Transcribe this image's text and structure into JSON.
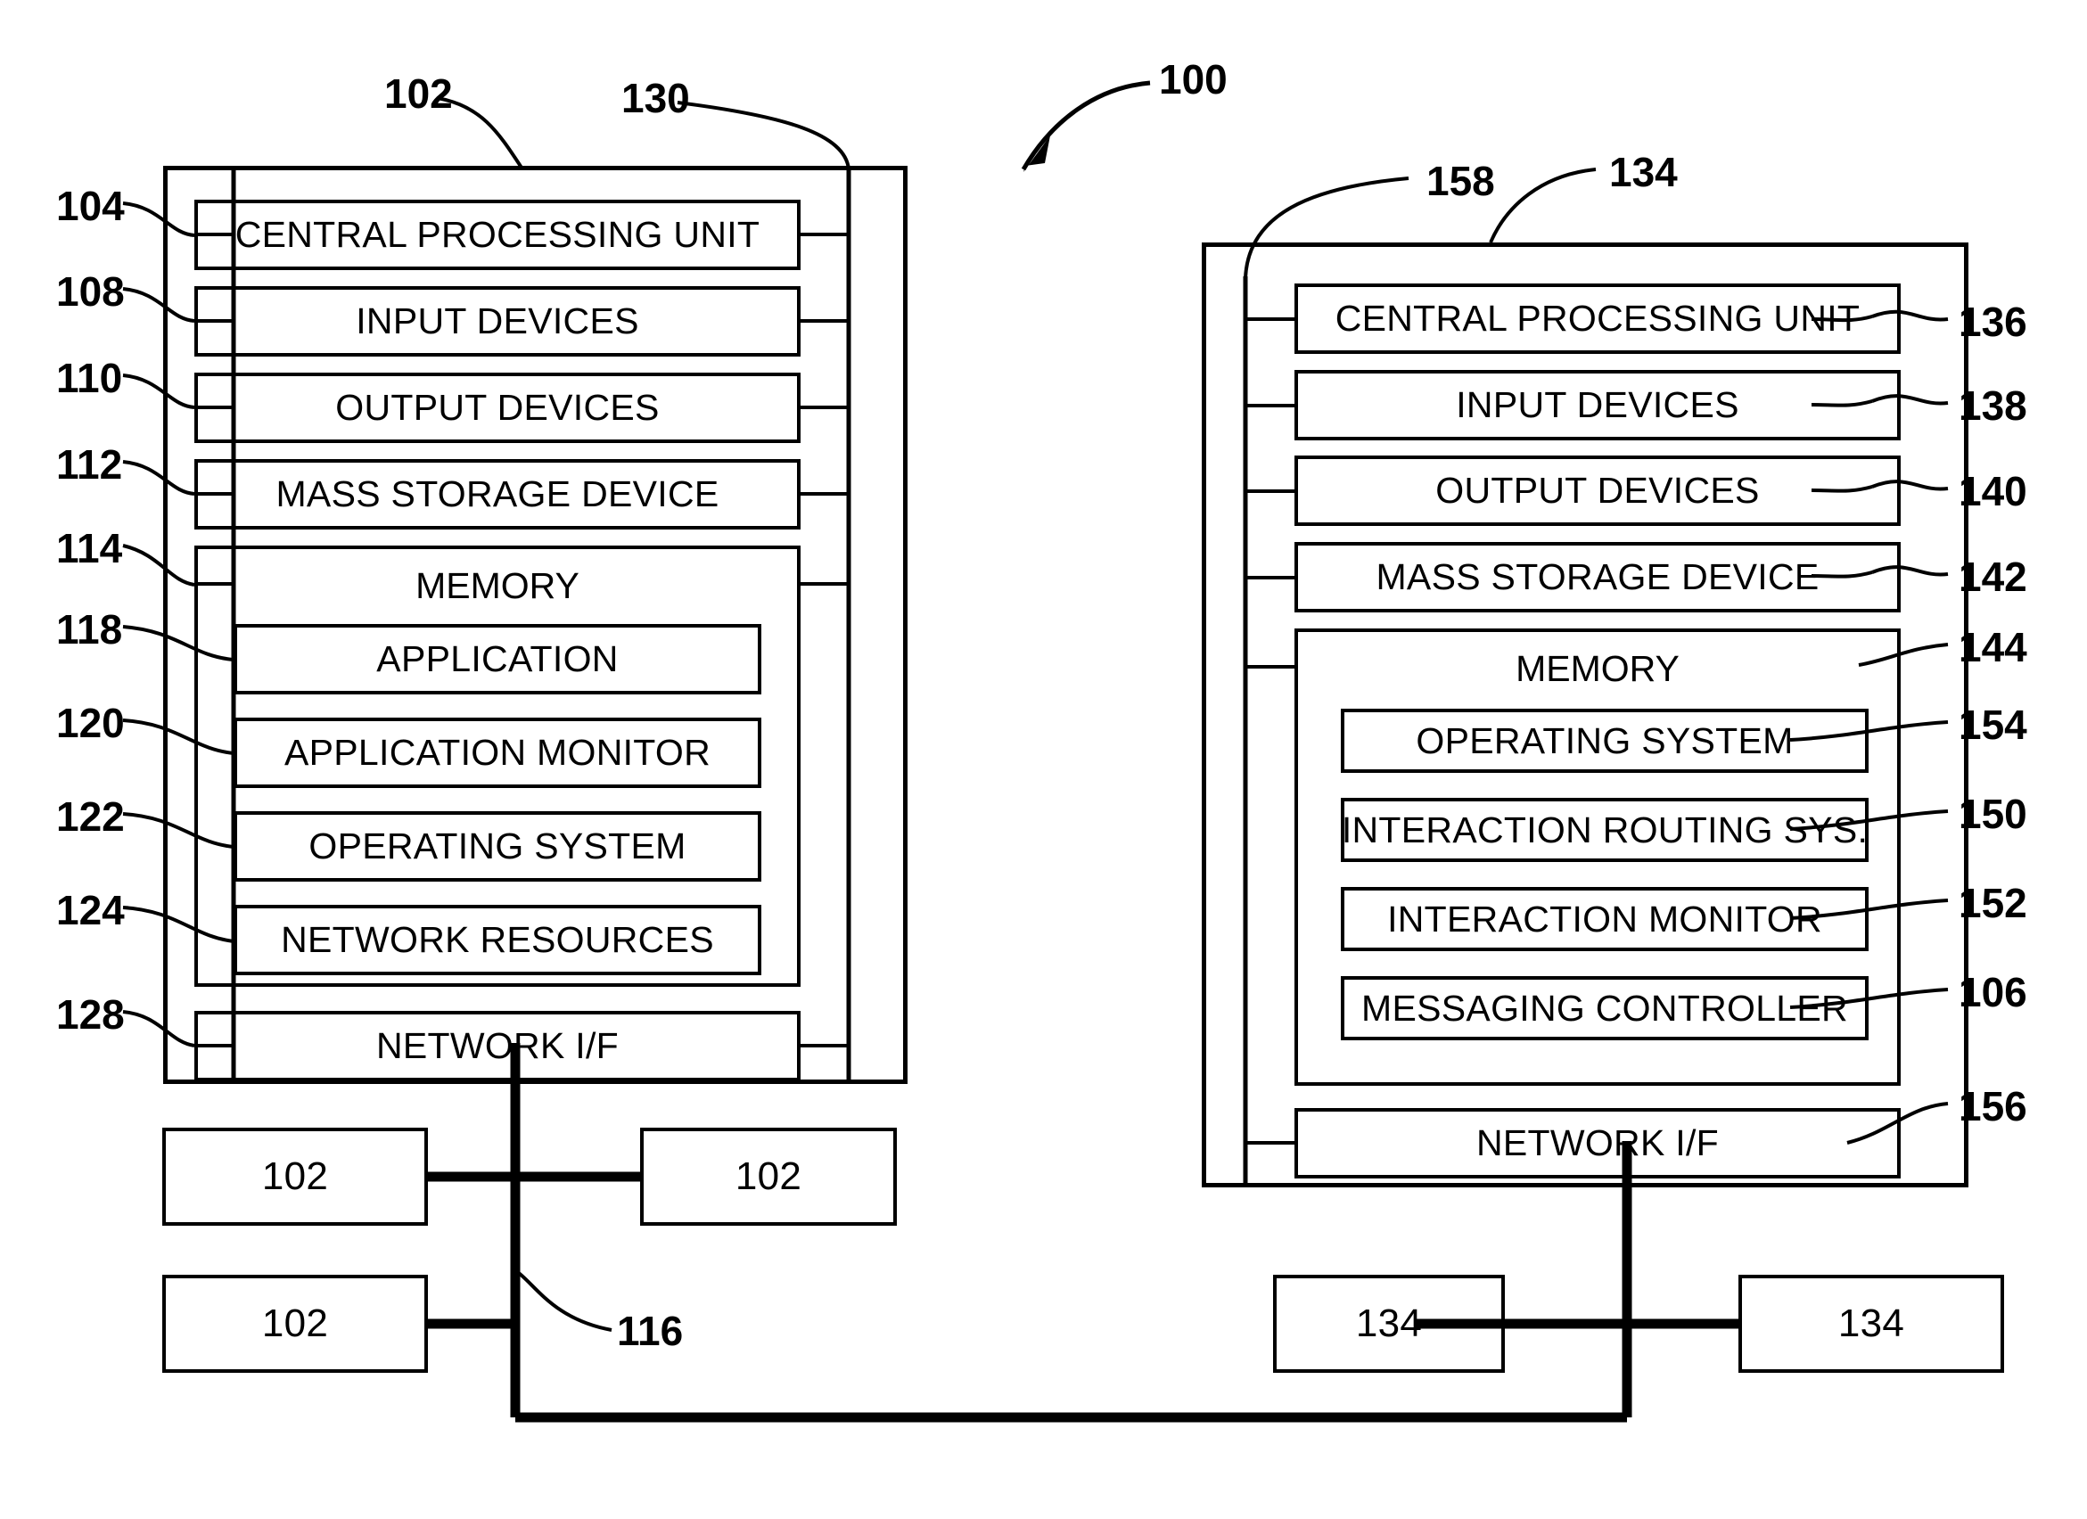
{
  "figure": {
    "title_ref": "100",
    "left_system": {
      "outer_ref": "102",
      "bus_ref": "130",
      "components": [
        {
          "label": "CENTRAL PROCESSING UNIT",
          "ref": "104"
        },
        {
          "label": "INPUT DEVICES",
          "ref": "108"
        },
        {
          "label": "OUTPUT DEVICES",
          "ref": "110"
        },
        {
          "label": "MASS STORAGE DEVICE",
          "ref": "112"
        }
      ],
      "memory": {
        "label": "MEMORY",
        "ref": "114",
        "items": [
          {
            "label": "APPLICATION",
            "ref": "118"
          },
          {
            "label": "APPLICATION MONITOR",
            "ref": "120"
          },
          {
            "label": "OPERATING SYSTEM",
            "ref": "122"
          },
          {
            "label": "NETWORK RESOURCES",
            "ref": "124"
          }
        ]
      },
      "network_if": {
        "label": "NETWORK I/F",
        "ref": "128"
      }
    },
    "right_system": {
      "outer_ref": "134",
      "bus_ref": "158",
      "components": [
        {
          "label": "CENTRAL PROCESSING UNIT",
          "ref": "136"
        },
        {
          "label": "INPUT DEVICES",
          "ref": "138"
        },
        {
          "label": "OUTPUT DEVICES",
          "ref": "140"
        },
        {
          "label": "MASS STORAGE DEVICE",
          "ref": "142"
        }
      ],
      "memory": {
        "label": "MEMORY",
        "ref": "144",
        "items": [
          {
            "label": "OPERATING SYSTEM",
            "ref": "154"
          },
          {
            "label": "INTERACTION ROUTING SYS.",
            "ref": "150"
          },
          {
            "label": "INTERACTION MONITOR",
            "ref": "152"
          },
          {
            "label": "MESSAGING CONTROLLER",
            "ref": "106"
          }
        ]
      },
      "network_if": {
        "label": "NETWORK I/F",
        "ref": "156"
      }
    },
    "network": {
      "ref": "116",
      "left_nodes": [
        {
          "label": "102"
        },
        {
          "label": "102"
        },
        {
          "label": "102"
        }
      ],
      "right_nodes": [
        {
          "label": "134"
        },
        {
          "label": "134"
        }
      ]
    },
    "colors": {
      "line": "#000000",
      "background": "#ffffff"
    }
  }
}
